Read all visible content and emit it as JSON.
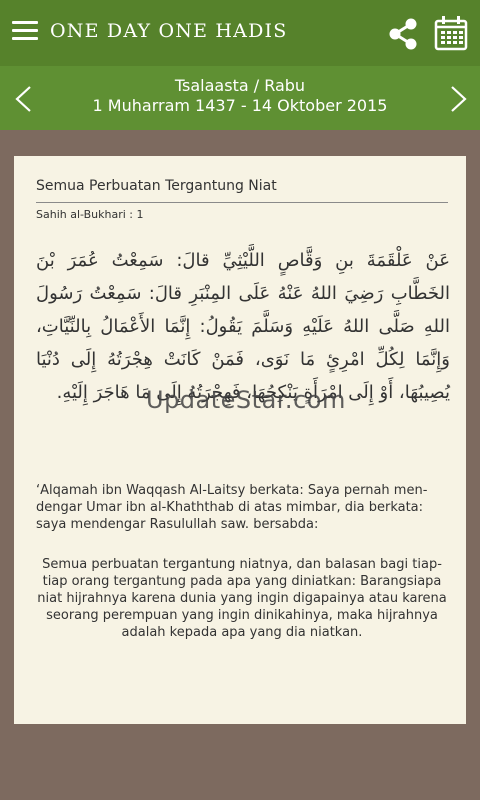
{
  "appbar": {
    "title": "ONE DAY ONE HADIS",
    "menu_icon": "hamburger-menu-icon",
    "share_icon": "share-icon",
    "calendar_icon": "calendar-icon"
  },
  "datebar": {
    "day": "Tsalaasta / Rabu",
    "date": "1 Muharram 1437 - 14 Oktober 2015",
    "prev_icon": "chevron-left-icon",
    "next_icon": "chevron-right-icon"
  },
  "hadith": {
    "title": "Semua Perbuatan Tergantung Niat",
    "source": "Sahih al-Bukhari : 1",
    "arabic": "عَنْ عَلْقَمَةَ بنِ وَقَّاصٍ اللَّيْثِيِّ قالَ: سَمِعْتُ عُمَرَ بْنَ الخَطَّابِ رَضِيَ اللهُ عَنْهُ عَلَى المِنْبَرِ قالَ: سَمِعْتُ رَسُولَ اللهِ صَلَّى اللهُ عَلَيْهِ وَسَلَّمَ يَقُولُ: إِنَّمَا الأَعْمَالُ بِالنِّيَّاتِ، وَإِنَّمَا لِكُلِّ امْرِئٍ مَا نَوَى، فَمَنْ كَانَتْ هِجْرَتُهُ إِلَى دُنْيَا يُصِيبُهَا، أَوْ إِلَى امْرَأَةٍ يَنْكِحُهَا، فَهِجْرَتُهُ إِلَى مَا هَاجَرَ إِلَيْهِ.",
    "translation": "‘Alqamah ibn Waqqash Al-Laitsy berkata: Saya pernah men­dengar Umar ibn al-Khaththab di atas mimbar, dia berkata: saya mendengar Rasulullah saw. bersabda:",
    "summary": "Semua perbuatan tergantung niatnya, dan balasan bagi tiap-tiap orang tergantung pada apa yang diniatkan: Barangsiapa niat hijrahnya karena dunia yang ingin digapainya atau karena seorang perempuan yang ingin dinikahinya, maka hijrahnya adalah kepada apa yang dia niatkan."
  },
  "watermark": "UpdateStar.com",
  "colors": {
    "appbar": "#56822b",
    "datebar": "#5f9033",
    "background": "#7d6a5f",
    "card": "#f7f3e4"
  }
}
